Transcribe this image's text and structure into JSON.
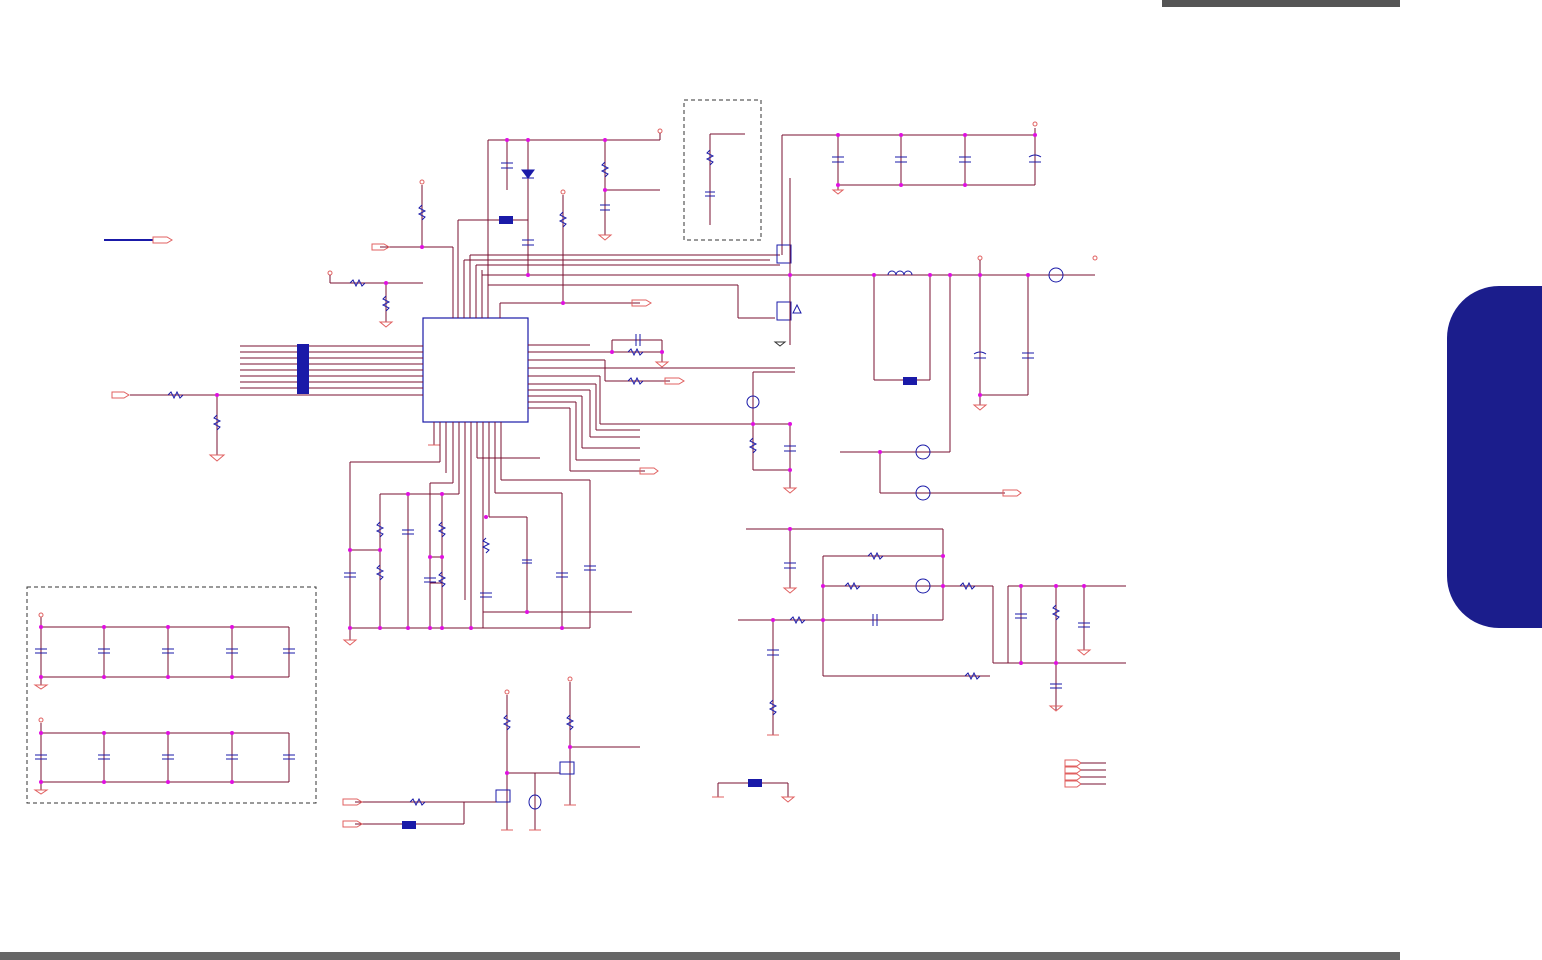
{
  "page": {
    "side_tab_label": "",
    "colors": {
      "wire": "#7a1030",
      "component": "#1a1aa8",
      "junction": "#e010e0",
      "port": "#e06060",
      "tab": "#1b1d8c",
      "bar": "#555555"
    }
  },
  "schematic": {
    "description_visible_text": "",
    "icons": [
      "resistor-icon",
      "capacitor-icon",
      "inductor-icon",
      "diode-icon",
      "mosfet-icon",
      "ground-icon",
      "power-rail-icon",
      "offpage-connector-icon",
      "jumper-icon",
      "ic-chip-icon"
    ]
  }
}
